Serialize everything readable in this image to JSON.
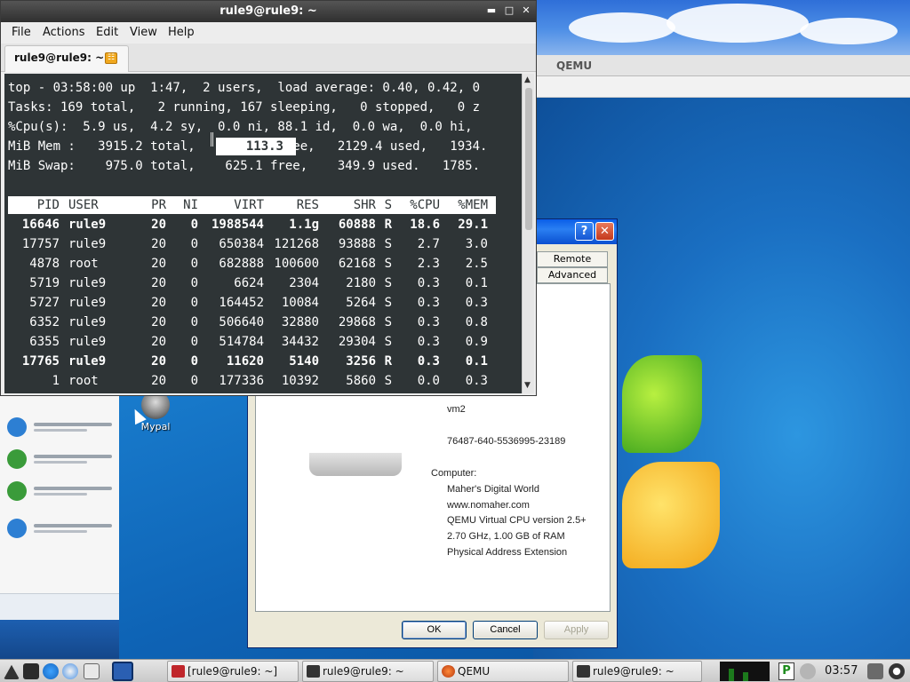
{
  "terminal": {
    "title": "rule9@rule9: ~",
    "menu": [
      "File",
      "Actions",
      "Edit",
      "View",
      "Help"
    ],
    "tab_label": "rule9@rule9: ~",
    "top_lines": [
      "top - 03:58:00 up  1:47,  2 users,  load average: 0.40, 0.42, 0",
      "Tasks: 169 total,   2 running, 167 sleeping,   0 stopped,   0 z",
      "%Cpu(s):  5.9 us,  4.2 sy,  0.0 ni, 88.1 id,  0.0 wa,  0.0 hi,",
      "MiB Mem :   3915.2 total,           free,   2129.4 used,   1934.",
      "MiB Swap:    975.0 total,    625.1 free,    349.9 used.   1785."
    ],
    "mem_free": "113.3",
    "columns": [
      "PID",
      "USER",
      "PR",
      "NI",
      "VIRT",
      "RES",
      "SHR",
      "S",
      "%CPU",
      "%MEM"
    ],
    "processes": [
      {
        "pid": "16646",
        "user": "rule9",
        "pr": "20",
        "ni": "0",
        "virt": "1988544",
        "res": "1.1g",
        "shr": "60888",
        "s": "R",
        "cpu": "18.6",
        "mem": "29.1",
        "bold": true
      },
      {
        "pid": "17757",
        "user": "rule9",
        "pr": "20",
        "ni": "0",
        "virt": "650384",
        "res": "121268",
        "shr": "93888",
        "s": "S",
        "cpu": "2.7",
        "mem": "3.0",
        "bold": false
      },
      {
        "pid": "4878",
        "user": "root",
        "pr": "20",
        "ni": "0",
        "virt": "682888",
        "res": "100600",
        "shr": "62168",
        "s": "S",
        "cpu": "2.3",
        "mem": "2.5",
        "bold": false
      },
      {
        "pid": "5719",
        "user": "rule9",
        "pr": "20",
        "ni": "0",
        "virt": "6624",
        "res": "2304",
        "shr": "2180",
        "s": "S",
        "cpu": "0.3",
        "mem": "0.1",
        "bold": false
      },
      {
        "pid": "5727",
        "user": "rule9",
        "pr": "20",
        "ni": "0",
        "virt": "164452",
        "res": "10084",
        "shr": "5264",
        "s": "S",
        "cpu": "0.3",
        "mem": "0.3",
        "bold": false
      },
      {
        "pid": "6352",
        "user": "rule9",
        "pr": "20",
        "ni": "0",
        "virt": "506640",
        "res": "32880",
        "shr": "29868",
        "s": "S",
        "cpu": "0.3",
        "mem": "0.8",
        "bold": false
      },
      {
        "pid": "6355",
        "user": "rule9",
        "pr": "20",
        "ni": "0",
        "virt": "514784",
        "res": "34432",
        "shr": "29304",
        "s": "S",
        "cpu": "0.3",
        "mem": "0.9",
        "bold": false
      },
      {
        "pid": "17765",
        "user": "rule9",
        "pr": "20",
        "ni": "0",
        "virt": "11620",
        "res": "5140",
        "shr": "3256",
        "s": "R",
        "cpu": "0.3",
        "mem": "0.1",
        "bold": true
      },
      {
        "pid": "1",
        "user": "root",
        "pr": "20",
        "ni": "0",
        "virt": "177336",
        "res": "10392",
        "shr": "5860",
        "s": "S",
        "cpu": "0.0",
        "mem": "0.3",
        "bold": false
      }
    ],
    "colors": {
      "background": "#2e3436",
      "foreground": "#ffffff"
    }
  },
  "qemu_window": {
    "title": "QEMU"
  },
  "system_properties": {
    "tabs": [
      "Remote",
      "Advanced"
    ],
    "help_glyph": "?",
    "close_glyph": "✕",
    "lines": [
      "vm2",
      "76487-640-5536995-23189",
      "Computer:",
      "Maher's Digital World",
      "www.nomaher.com",
      "QEMU Virtual CPU version 2.5+",
      "2.70 GHz, 1.00 GB of RAM",
      "Physical Address Extension"
    ],
    "buttons": {
      "ok": "OK",
      "cancel": "Cancel",
      "apply": "Apply"
    }
  },
  "desktop": {
    "icons": [
      {
        "label": "Mypal",
        "icon": "raccoon-icon"
      }
    ]
  },
  "taskbar": {
    "launchers": [
      "menu-icon",
      "minimize-all-icon",
      "browser-icon",
      "file-manager-icon",
      "terminal-icon",
      "qemu-icon"
    ],
    "tasks": [
      {
        "label": "[rule9@rule9: ~]",
        "icon": "text-editor-icon"
      },
      {
        "label": "rule9@rule9: ~",
        "icon": "terminal-icon"
      },
      {
        "label": "QEMU",
        "icon": "qemu-icon"
      },
      {
        "label": "rule9@rule9: ~",
        "icon": "terminal-icon"
      }
    ],
    "tray_p": "P",
    "clock": "03:57"
  }
}
